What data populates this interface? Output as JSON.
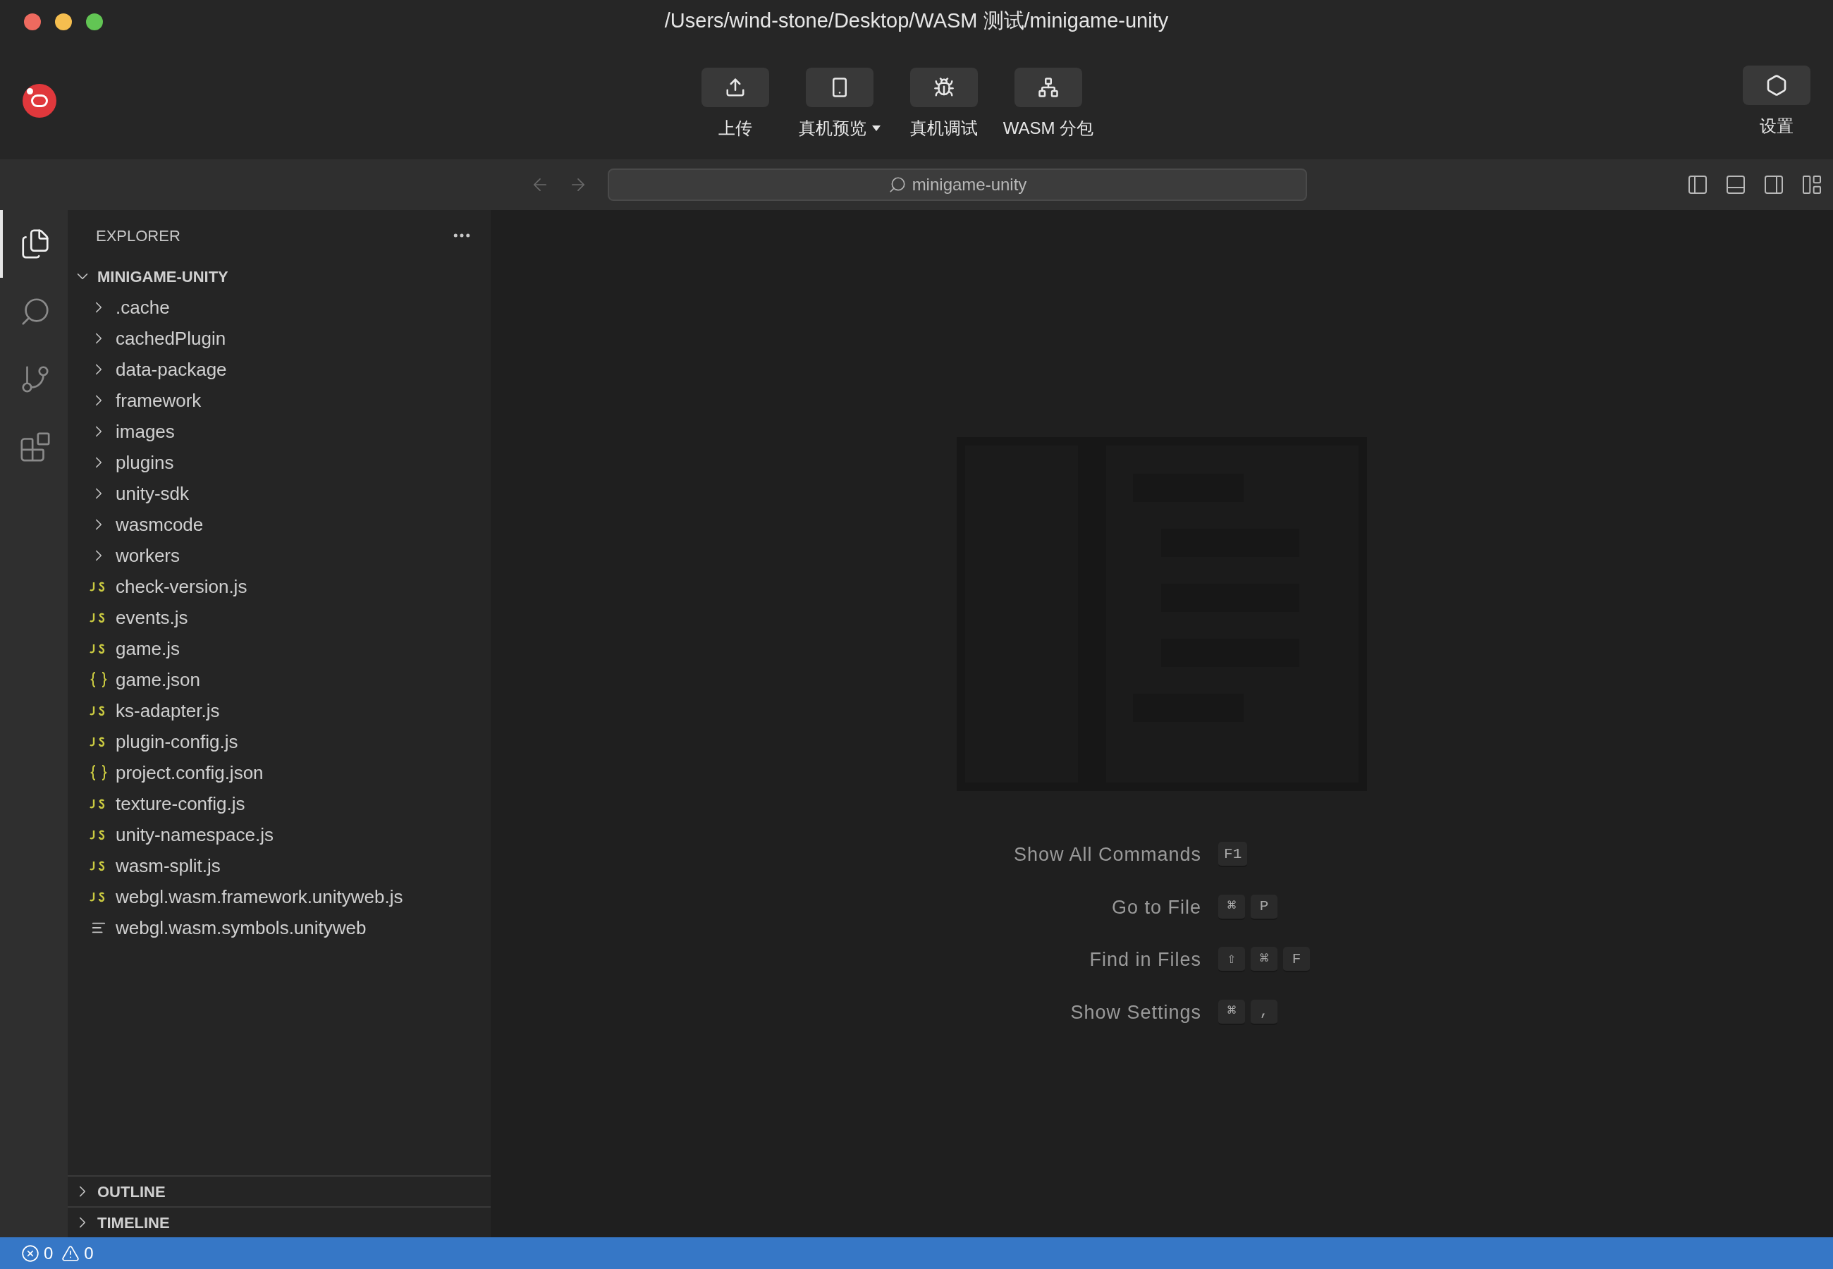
{
  "window": {
    "title": "/Users/wind-stone/Desktop/WASM 测试/minigame-unity"
  },
  "toolbar": {
    "buttons": [
      {
        "kind": "upload",
        "label": "上传",
        "has_menu": false
      },
      {
        "kind": "device",
        "label": "真机预览",
        "has_menu": true
      },
      {
        "kind": "debug",
        "label": "真机调试",
        "has_menu": false
      },
      {
        "kind": "split",
        "label": "WASM 分包",
        "has_menu": false
      }
    ],
    "settings": {
      "label": "设置"
    }
  },
  "command_center": {
    "label": "minigame-unity"
  },
  "activity_bar": [
    {
      "kind": "explorer",
      "selected": true
    },
    {
      "kind": "search",
      "selected": false
    },
    {
      "kind": "source-control",
      "selected": false
    },
    {
      "kind": "extensions",
      "selected": false
    }
  ],
  "explorer": {
    "title": "EXPLORER",
    "root": {
      "label": "MINIGAME-UNITY",
      "expanded": true,
      "children": [
        {
          "kind": "folder",
          "label": ".cache",
          "expanded": false
        },
        {
          "kind": "folder",
          "label": "cachedPlugin",
          "expanded": false
        },
        {
          "kind": "folder",
          "label": "data-package",
          "expanded": false
        },
        {
          "kind": "folder",
          "label": "framework",
          "expanded": false
        },
        {
          "kind": "folder",
          "label": "images",
          "expanded": false
        },
        {
          "kind": "folder",
          "label": "plugins",
          "expanded": false
        },
        {
          "kind": "folder",
          "label": "unity-sdk",
          "expanded": false
        },
        {
          "kind": "folder",
          "label": "wasmcode",
          "expanded": false
        },
        {
          "kind": "folder",
          "label": "workers",
          "expanded": false
        },
        {
          "kind": "js",
          "label": "check-version.js"
        },
        {
          "kind": "js",
          "label": "events.js"
        },
        {
          "kind": "js",
          "label": "game.js"
        },
        {
          "kind": "json",
          "label": "game.json"
        },
        {
          "kind": "js",
          "label": "ks-adapter.js"
        },
        {
          "kind": "js",
          "label": "plugin-config.js"
        },
        {
          "kind": "json",
          "label": "project.config.json"
        },
        {
          "kind": "js",
          "label": "texture-config.js"
        },
        {
          "kind": "js",
          "label": "unity-namespace.js"
        },
        {
          "kind": "js",
          "label": "wasm-split.js"
        },
        {
          "kind": "js",
          "label": "webgl.wasm.framework.unityweb.js"
        },
        {
          "kind": "text",
          "label": "webgl.wasm.symbols.unityweb"
        }
      ]
    },
    "sections": [
      {
        "label": "OUTLINE",
        "expanded": false
      },
      {
        "label": "TIMELINE",
        "expanded": false
      }
    ]
  },
  "welcome": {
    "shortcuts": [
      {
        "label": "Show All Commands",
        "keys": [
          "F1"
        ]
      },
      {
        "label": "Go to File",
        "keys": [
          "⌘",
          "P"
        ]
      },
      {
        "label": "Find in Files",
        "keys": [
          "⇧",
          "⌘",
          "F"
        ]
      },
      {
        "label": "Show Settings",
        "keys": [
          "⌘",
          ","
        ]
      }
    ]
  },
  "status_bar": {
    "errors": "0",
    "warnings": "0"
  }
}
